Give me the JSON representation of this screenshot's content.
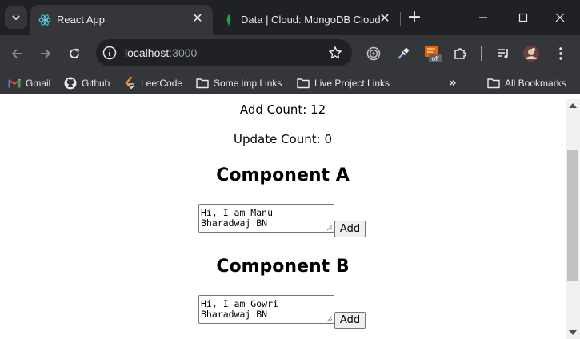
{
  "colors": {
    "tabstrip_bg": "#202124",
    "toolbar_bg": "#35363a",
    "text_light": "#e8eaed",
    "page_bg": "#ffffff"
  },
  "tabs": [
    {
      "title": "React App",
      "icon": "react-logo-icon",
      "active": true,
      "close": "✕"
    },
    {
      "title": "Data | Cloud: MongoDB Cloud",
      "icon": "mongodb-leaf-icon",
      "active": false,
      "close": "✕"
    }
  ],
  "new_tab": "+",
  "address_bar": {
    "host": "localhost",
    "port": ":3000"
  },
  "extensions": [
    "target-icon",
    "eyedropper-icon",
    "extension-off-icon",
    "puzzle-icon",
    "media-queue-icon",
    "profile-avatar-icon",
    "kebab-menu-icon"
  ],
  "extension_badge": "off",
  "bookmarks": {
    "items": [
      {
        "label": "Gmail",
        "icon": "gmail-icon"
      },
      {
        "label": "Github",
        "icon": "github-icon"
      },
      {
        "label": "LeetCode",
        "icon": "leetcode-icon"
      },
      {
        "label": "Some imp Links",
        "icon": "folder-icon"
      },
      {
        "label": "Live Project Links",
        "icon": "folder-icon"
      }
    ],
    "more": "»",
    "all_bookmarks": "All Bookmarks"
  },
  "page": {
    "add_count": "Add Count: 12",
    "update_count": "Update Count: 0",
    "components": [
      {
        "heading": "Component A",
        "text": "Hi, I am Manu\nBharadwaj BN",
        "button": "Add"
      },
      {
        "heading": "Component B",
        "text": "Hi, I am Gowri\nBharadwaj BN",
        "button": "Add"
      }
    ]
  }
}
